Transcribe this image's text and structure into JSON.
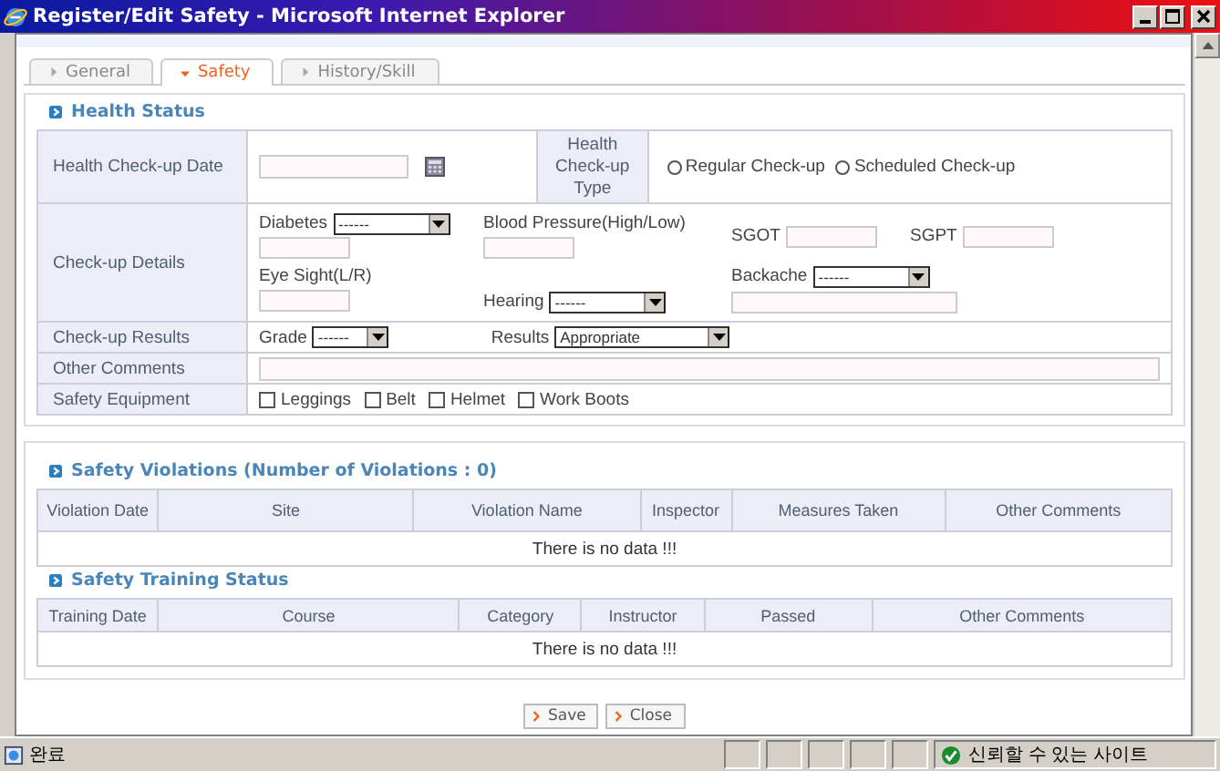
{
  "window": {
    "title": "Register/Edit Safety - Microsoft Internet Explorer"
  },
  "tabs": [
    {
      "label": "General",
      "selected": false
    },
    {
      "label": "Safety",
      "selected": true
    },
    {
      "label": "History/Skill",
      "selected": false
    }
  ],
  "health_status": {
    "title": "Health Status",
    "checkup_date": {
      "label": "Health Check-up Date"
    },
    "checkup_type": {
      "label": "Health Check-up Type",
      "options": [
        {
          "label": "Regular Check-up",
          "selected": false
        },
        {
          "label": "Scheduled Check-up",
          "selected": false
        }
      ]
    },
    "checkup_details": {
      "label": "Check-up Details",
      "fields": [
        {
          "kind": "select_input",
          "label": "Diabetes",
          "value": "------"
        },
        {
          "kind": "input_below",
          "label": "Blood Pressure(High/Low)"
        },
        {
          "kind": "inline_input",
          "label": "SGOT"
        },
        {
          "kind": "inline_input",
          "label": "SGPT"
        },
        {
          "kind": "input_below",
          "label": "Eye Sight(L/R)"
        },
        {
          "kind": "inline_select",
          "label": "Hearing",
          "value": "------"
        },
        {
          "kind": "select_input",
          "label": "Backache",
          "value": "------"
        }
      ]
    },
    "checkup_results": {
      "label": "Check-up Results",
      "grade": {
        "label": "Grade",
        "value": "------"
      },
      "results": {
        "label": "Results",
        "value": "Appropriate"
      }
    },
    "other_comments": {
      "label": "Other Comments"
    },
    "safety_equipment": {
      "label": "Safety Equipment",
      "items": [
        {
          "label": "Leggings",
          "checked": false
        },
        {
          "label": "Belt",
          "checked": false
        },
        {
          "label": "Helmet",
          "checked": false
        },
        {
          "label": "Work Boots",
          "checked": false
        }
      ]
    }
  },
  "violations": {
    "title": "Safety Violations (Number of Violations : 0)",
    "columns": [
      "Violation Date",
      "Site",
      "Violation Name",
      "Inspector",
      "Measures Taken",
      "Other Comments"
    ],
    "empty_text": "There is no data !!!"
  },
  "training": {
    "title": "Safety Training Status",
    "columns": [
      "Training Date",
      "Course",
      "Category",
      "Instructor",
      "Passed",
      "Other Comments"
    ],
    "empty_text": "There is no data !!!"
  },
  "buttons": [
    {
      "label": "Save"
    },
    {
      "label": "Close"
    }
  ],
  "status_bar": {
    "text": "완료",
    "zone": "신뢰할 수 있는 사이트"
  }
}
